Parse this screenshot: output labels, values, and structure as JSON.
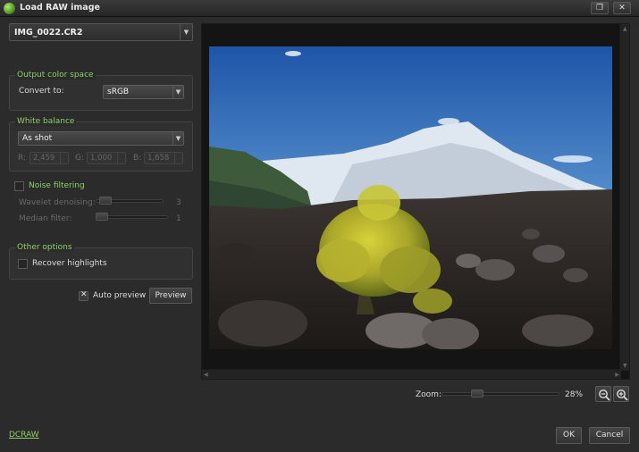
{
  "window": {
    "title": "Load RAW image",
    "restore_glyph": "❐",
    "close_glyph": "✕"
  },
  "file": {
    "value": "IMG_0022.CR2"
  },
  "output_color_space": {
    "title": "Output color space",
    "convert_label": "Convert to:",
    "convert_value": "sRGB"
  },
  "white_balance": {
    "title": "White balance",
    "mode": "As shot",
    "r_label": "R:",
    "r_value": "2,459",
    "g_label": "G:",
    "g_value": "1,000",
    "b_label": "B:",
    "b_value": "1,658"
  },
  "noise_filtering": {
    "title": "Noise filtering",
    "checked": false,
    "wavelet_label": "Wavelet denoising:",
    "wavelet_value": "3",
    "median_label": "Median filter:",
    "median_value": "1"
  },
  "other_options": {
    "title": "Other options",
    "recover_label": "Recover highlights",
    "recover_checked": false
  },
  "auto_preview": {
    "label": "Auto preview",
    "checked": true
  },
  "preview_button": "Preview",
  "zoom": {
    "label": "Zoom:",
    "value": "28%",
    "level": 0.28
  },
  "footer": {
    "link": "DCRAW",
    "ok": "OK",
    "cancel": "Cancel"
  },
  "icons": {
    "app": "app-logo-icon",
    "zoom_out": "zoom-out-icon",
    "zoom_in": "zoom-in-icon",
    "dropdown": "chevron-down-icon"
  },
  "colors": {
    "accent": "#8cd067",
    "background": "#2b2b2b"
  }
}
